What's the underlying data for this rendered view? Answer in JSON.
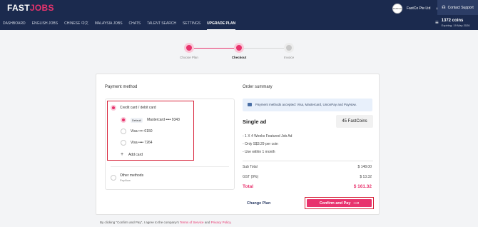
{
  "header": {
    "logo_prefix": "FAST",
    "logo_suffix": "JOBS",
    "company_avatar_text": "FASTCO",
    "company_name": "FastCo Pte Ltd",
    "contact_label": "Contact Support"
  },
  "nav": {
    "items": [
      "DASHBOARD",
      "ENGLISH JOBS",
      "CHINESE 中文",
      "MALAYSIA JOBS",
      "CHATS",
      "TALENT SEARCH",
      "SETTINGS",
      "UPGRADE PLAN"
    ],
    "active_index": 7
  },
  "coins": {
    "amount": "1372 coins",
    "expiry": "Expiring: 19 May 2026"
  },
  "stepper": {
    "steps": [
      "Choose Plan",
      "Checkout",
      "Invoice"
    ],
    "current_index": 1
  },
  "payment": {
    "title": "Payment method",
    "credit_label": "Credit card / debit card",
    "default_badge": "Default",
    "cards": [
      "Mastercard •••• 9343",
      "Visa •••• 0150",
      "Visa •••• 7264"
    ],
    "selected_card_index": 0,
    "add_card": "Add card",
    "other_label": "Other methods",
    "other_sub": "PayNow"
  },
  "order": {
    "title": "Order summary",
    "info": "Payment methods accepted: Visa, Mastercard, UnionPay and PayNow.",
    "plan_name": "Single ad",
    "plan_price": "45 FastCoins",
    "bullets": [
      "- 1 X 4 Weeks Featured Job Ad",
      "- Only S$3.29 per coin",
      "- Use within 1 month"
    ],
    "subtotal_label": "Sub Total",
    "subtotal_value": "$ 148.00",
    "gst_label": "GST (9%)",
    "gst_value": "$ 13.32",
    "total_label": "Total",
    "total_value": "$ 161.32"
  },
  "actions": {
    "change_plan": "Change Plan",
    "confirm": "Confirm and Pay",
    "confirm_arrow": "⟶"
  },
  "footer": {
    "prefix": "By clicking \"Confirm and Pay\", I agree to the company's",
    "terms": "Terms of Service",
    "and": "and",
    "privacy": "Privacy Policy",
    "end": "."
  },
  "colors": {
    "brand": "#e8336d",
    "header_bg": "#1b2a4e",
    "highlight_border": "#d8243b"
  }
}
